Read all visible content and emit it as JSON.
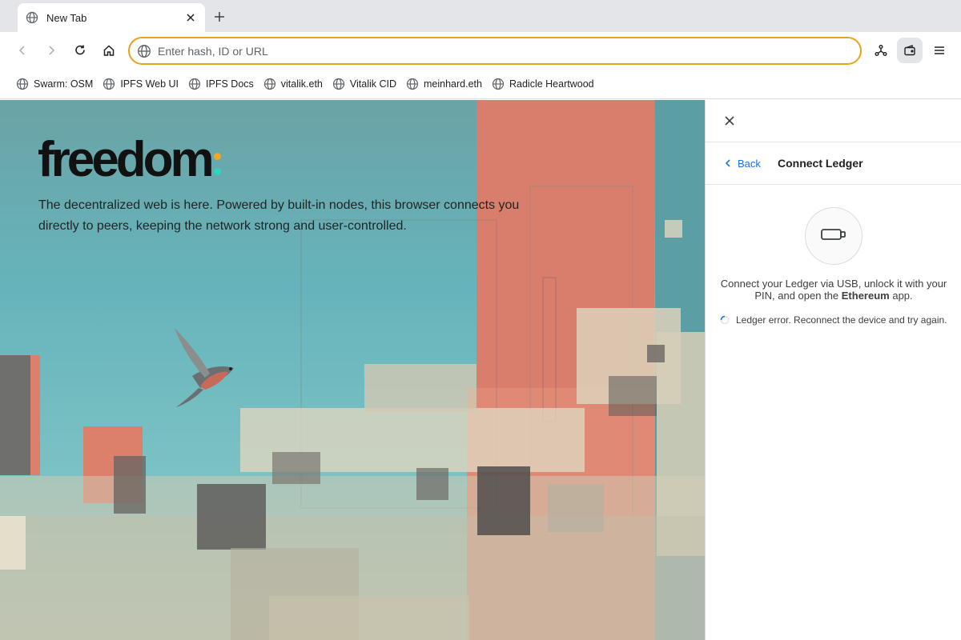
{
  "tab": {
    "title": "New Tab",
    "icon": "globe-icon"
  },
  "toolbar": {
    "back_icon": "arrow-left-icon",
    "forward_icon": "arrow-right-icon",
    "reload_icon": "reload-icon",
    "home_icon": "home-icon",
    "omnibox_placeholder": "Enter hash, ID or URL",
    "omnibox_value": "",
    "nodes_icon": "network-icon",
    "wallet_icon": "wallet-icon",
    "menu_icon": "menu-icon",
    "accent_color": "#e8a317"
  },
  "bookmarks": [
    {
      "label": "Swarm: OSM"
    },
    {
      "label": "IPFS Web UI"
    },
    {
      "label": "IPFS Docs"
    },
    {
      "label": "vitalik.eth"
    },
    {
      "label": "Vitalik CID"
    },
    {
      "label": "meinhard.eth"
    },
    {
      "label": "Radicle Heartwood"
    }
  ],
  "page": {
    "logo_text": "freedom",
    "logo_dot_colors": [
      "#f5a623",
      "#2dd4bf"
    ],
    "tagline": "The decentralized web is here. Powered by built-in nodes, this browser connects you directly to peers, keeping the network strong and user-controlled."
  },
  "panel": {
    "back_label": "Back",
    "title": "Connect Ledger",
    "instruction_prefix": "Connect your Ledger via USB, unlock it with your PIN, and open the ",
    "instruction_app": "Ethereum",
    "instruction_suffix": " app.",
    "status_text": "Ledger error. Reconnect the device and try again.",
    "device_icon": "ledger-device-icon"
  }
}
